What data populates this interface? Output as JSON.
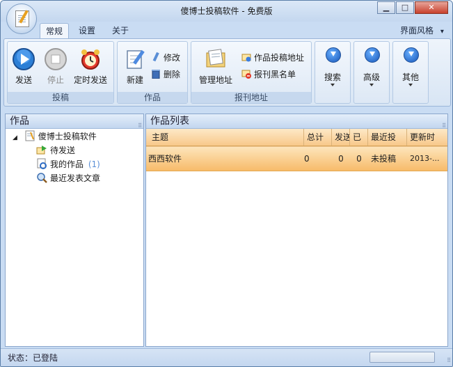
{
  "window": {
    "title": "傻博士投稿软件 - 免费版",
    "controls": {
      "minimize": "▁",
      "maximize": "□",
      "close": "✕"
    }
  },
  "menu": {
    "tabs": [
      {
        "label": "常规"
      },
      {
        "label": "设置"
      },
      {
        "label": "关于"
      }
    ],
    "skin": {
      "label": "界面风格",
      "arrow": "▾"
    }
  },
  "ribbon": {
    "groups": [
      {
        "label": "投稿",
        "buttons": [
          {
            "label": "发送",
            "icon": "play-icon"
          },
          {
            "label": "停止",
            "icon": "stop-icon"
          },
          {
            "label": "定时发送",
            "icon": "alarm-clock-icon"
          }
        ]
      },
      {
        "label": "作品",
        "buttons": [
          {
            "label": "新建",
            "icon": "new-doc-icon"
          },
          {
            "label": "修改",
            "icon": "edit-icon"
          },
          {
            "label": "删除",
            "icon": "trash-icon"
          }
        ]
      },
      {
        "label": "报刊地址",
        "buttons": [
          {
            "label": "管理地址",
            "icon": "address-book-icon"
          },
          {
            "label": "作品投稿地址",
            "icon": "mail-address-icon"
          },
          {
            "label": "报刊黑名单",
            "icon": "blacklist-icon"
          }
        ]
      }
    ],
    "dropdowns": [
      {
        "label": "搜索"
      },
      {
        "label": "高级"
      },
      {
        "label": "其他"
      }
    ]
  },
  "left_pane": {
    "title": "作品",
    "tree": {
      "expander": "◢",
      "root": "傻博士投稿软件",
      "children": [
        {
          "label": "待发送"
        },
        {
          "label": "我的作品",
          "count": "(1)"
        },
        {
          "label": "最近发表文章"
        }
      ]
    }
  },
  "right_pane": {
    "title": "作品列表",
    "columns": [
      "主题",
      "总计",
      "发送",
      "已",
      "最近投",
      "更新时"
    ],
    "rows": [
      {
        "cells": [
          "西西软件",
          "0",
          "0",
          "0",
          "未投稿",
          "2013-..."
        ]
      }
    ]
  },
  "status": {
    "text": "状态：已登陆"
  },
  "colors": {
    "accent": "#1656b8",
    "row_highlight": "#f7bb6a",
    "chrome": "#c9dcf3"
  }
}
